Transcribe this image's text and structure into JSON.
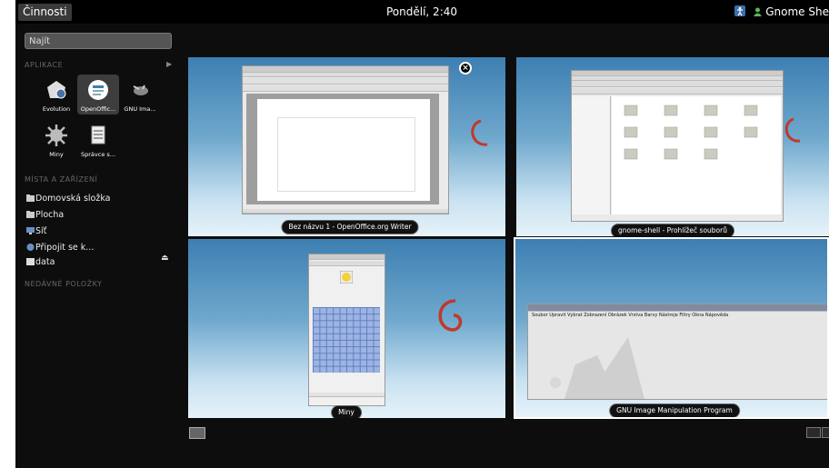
{
  "topbar": {
    "activities": "Činnosti",
    "clock": "Pondělí, 2:40",
    "user": "Gnome She"
  },
  "sidebar": {
    "search_placeholder": "Najít",
    "sections": {
      "apps": "APLIKACE",
      "places": "MÍSTA A ZAŘÍZENÍ",
      "recent": "NEDÁVNÉ POLOŽKY"
    },
    "apps": [
      {
        "label": "Evolution",
        "icon": "evolution-icon"
      },
      {
        "label": "OpenOffic...",
        "icon": "openoffice-icon"
      },
      {
        "label": "GNU Ima...",
        "icon": "gimp-icon"
      },
      {
        "label": "Miny",
        "icon": "mines-icon"
      },
      {
        "label": "Správce s...",
        "icon": "file-manager-icon"
      }
    ],
    "places": [
      {
        "label": "Domovská složka",
        "icon": "folder-icon"
      },
      {
        "label": "Plocha",
        "icon": "folder-icon"
      },
      {
        "label": "Síť",
        "icon": "network-icon"
      },
      {
        "label": "Připojit se k...",
        "icon": "connect-icon"
      },
      {
        "label": "data",
        "icon": "drive-icon"
      }
    ]
  },
  "windows": [
    {
      "caption": "Bez názvu 1 - OpenOffice.org Writer"
    },
    {
      "caption": "gnome-shell - Prohlížeč souborů"
    },
    {
      "caption": "Miny"
    },
    {
      "caption": "GNU Image Manipulation Program"
    }
  ],
  "gimp_menu": "Soubor  Upravit  Vybrat  Zobrazení  Obrázek  Vrstva  Barvy  Nástroje  Filtry  Okna  Nápověda",
  "colors": {
    "panel": "#000000",
    "overview": "#0d0d0d",
    "accent": "#3d7fb2"
  }
}
